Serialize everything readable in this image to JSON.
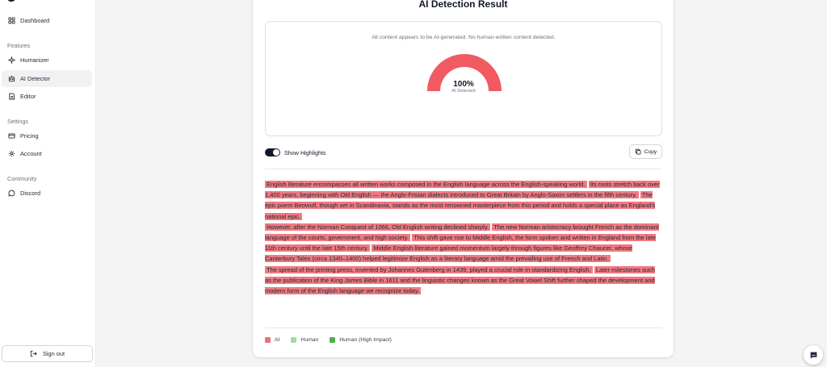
{
  "sidebar": {
    "dashboard_label": "Dashboard",
    "section_features": "Features",
    "humanizer_label": "Humanizer",
    "ai_detector_label": "AI Detector",
    "editor_label": "Editor",
    "section_settings": "Settings",
    "pricing_label": "Pricing",
    "account_label": "Account",
    "section_community": "Community",
    "discord_label": "Discord",
    "signout_label": "Sign out",
    "active_item": "AI Detector"
  },
  "result": {
    "title": "AI Detection Result",
    "message": "All content appears to be AI-generated. No human-written content detected.",
    "percent_value": 100,
    "percent_text": "100%",
    "gauge_label": "AI Detected",
    "gauge_color": "#f25a62",
    "gauge_track_color": "#fde2e4"
  },
  "controls": {
    "show_highlights_label": "Show Highlights",
    "show_highlights_on": true,
    "copy_label": "Copy"
  },
  "text": {
    "paragraphs": [
      [
        "English literature encompasses all written works composed in the English language across the English-speaking world.",
        "Its roots stretch back over 1,400 years, beginning with Old English — the Anglo-Frisian dialects introduced to Great Britain by Anglo-Saxon settlers in the fifth century.",
        "The epic poem Beowulf, though set in Scandinavia, stands as the most renowned masterpiece from this period and holds a special place as England's national epic."
      ],
      [
        "However, after the Norman Conquest of 1066, Old English writing declined sharply.",
        "The new Norman aristocracy brought French as the dominant language of the courts, government, and high society.",
        "This shift gave rise to Middle English, the form spoken and written in England from the late 11th century until the late 15th century.",
        "Middle English literature gained momentum largely through figures like Geoffrey Chaucer, whose Canterbury Tales (circa 1340–1400) helped legitimize English as a literary language amid the prevailing use of French and Latin."
      ],
      [
        "The spread of the printing press, invented by Johannes Gutenberg in 1439, played a crucial role in standardizing English.",
        "Later milestones such as the publication of the King James Bible in 1611 and the linguistic changes known as the Great Vowel Shift further shaped the development and modern form of the English language we recognize today."
      ]
    ]
  },
  "legend": {
    "ai_label": "AI",
    "ai_color": "#e8727a",
    "human_label": "Human",
    "human_color": "#9fdc9f",
    "human_high_label": "Human (High Impact)",
    "human_high_color": "#4caf50"
  },
  "icons": {
    "dashboard": "grid-icon",
    "humanizer": "sparkle-icon",
    "ai_detector": "robot-icon",
    "editor": "document-icon",
    "pricing": "credit-card-icon",
    "account": "gear-icon",
    "discord": "chat-bubble-icon",
    "signout": "logout-icon",
    "copy": "copy-icon",
    "chat": "message-icon"
  }
}
